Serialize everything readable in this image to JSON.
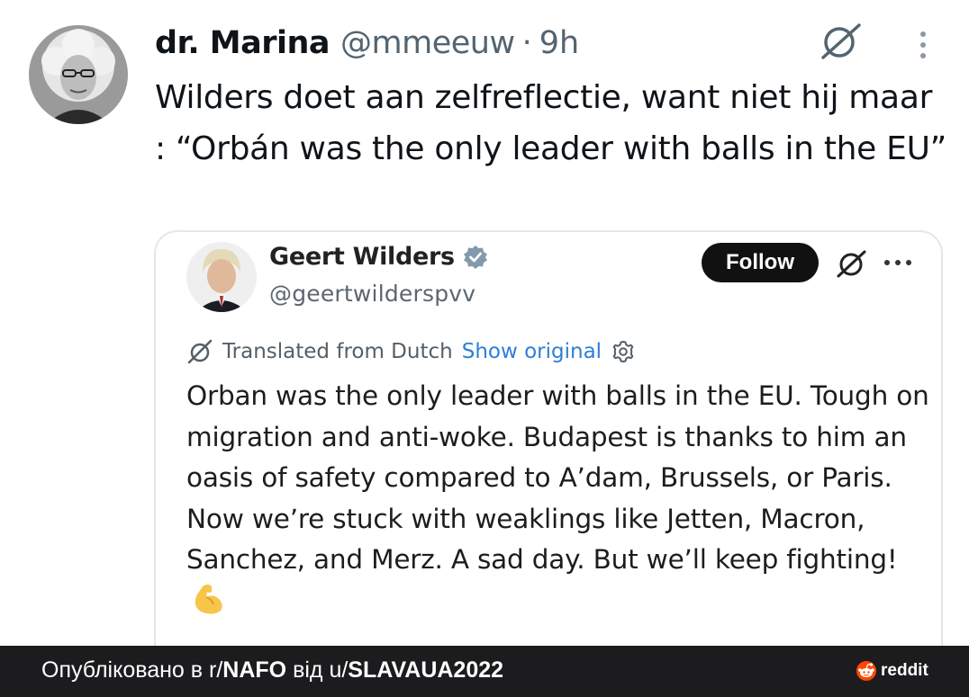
{
  "tweet": {
    "display_name": "dr. Marina",
    "handle": "@mmeeuw",
    "separator": "·",
    "time": "9h",
    "text": "Wilders doet aan zelfreflectie, want niet hij maar : “Orbán was the only leader with balls in the EU”",
    "icons": [
      "grok-icon",
      "more-vertical-icon"
    ]
  },
  "quote": {
    "display_name": "Geert Wilders",
    "handle": "@geertwilderspvv",
    "follow_label": "Follow",
    "translated_label": "Translated from Dutch",
    "show_original_label": "Show original",
    "text": "Orban was the only leader with balls in the EU. Tough on migration and anti-woke. Budapest is thanks to him an oasis of safety compared to A’dam, Brussels, or Paris. Now we’re stuck with weaklings like Jetten, Macron, Sanchez, and Merz. A sad day. But we’ll keep fighting!",
    "emoji": "flexed-biceps",
    "icons": [
      "verified-badge-icon",
      "grok-icon",
      "more-horizontal-icon",
      "translate-icon",
      "gear-icon"
    ]
  },
  "footer": {
    "prefix": "Опубліковано в r/",
    "subreddit": "NAFO",
    "middle": " від u/",
    "user": "SLAVAUA2022",
    "brand": "reddit"
  },
  "colors": {
    "text": "#0f1419",
    "secondary": "#536471",
    "link": "#2d7fd6",
    "verified": "#829aab",
    "follow_bg": "#111111",
    "footer_bg": "#1c1c1e",
    "reddit_orange": "#ff4500"
  }
}
